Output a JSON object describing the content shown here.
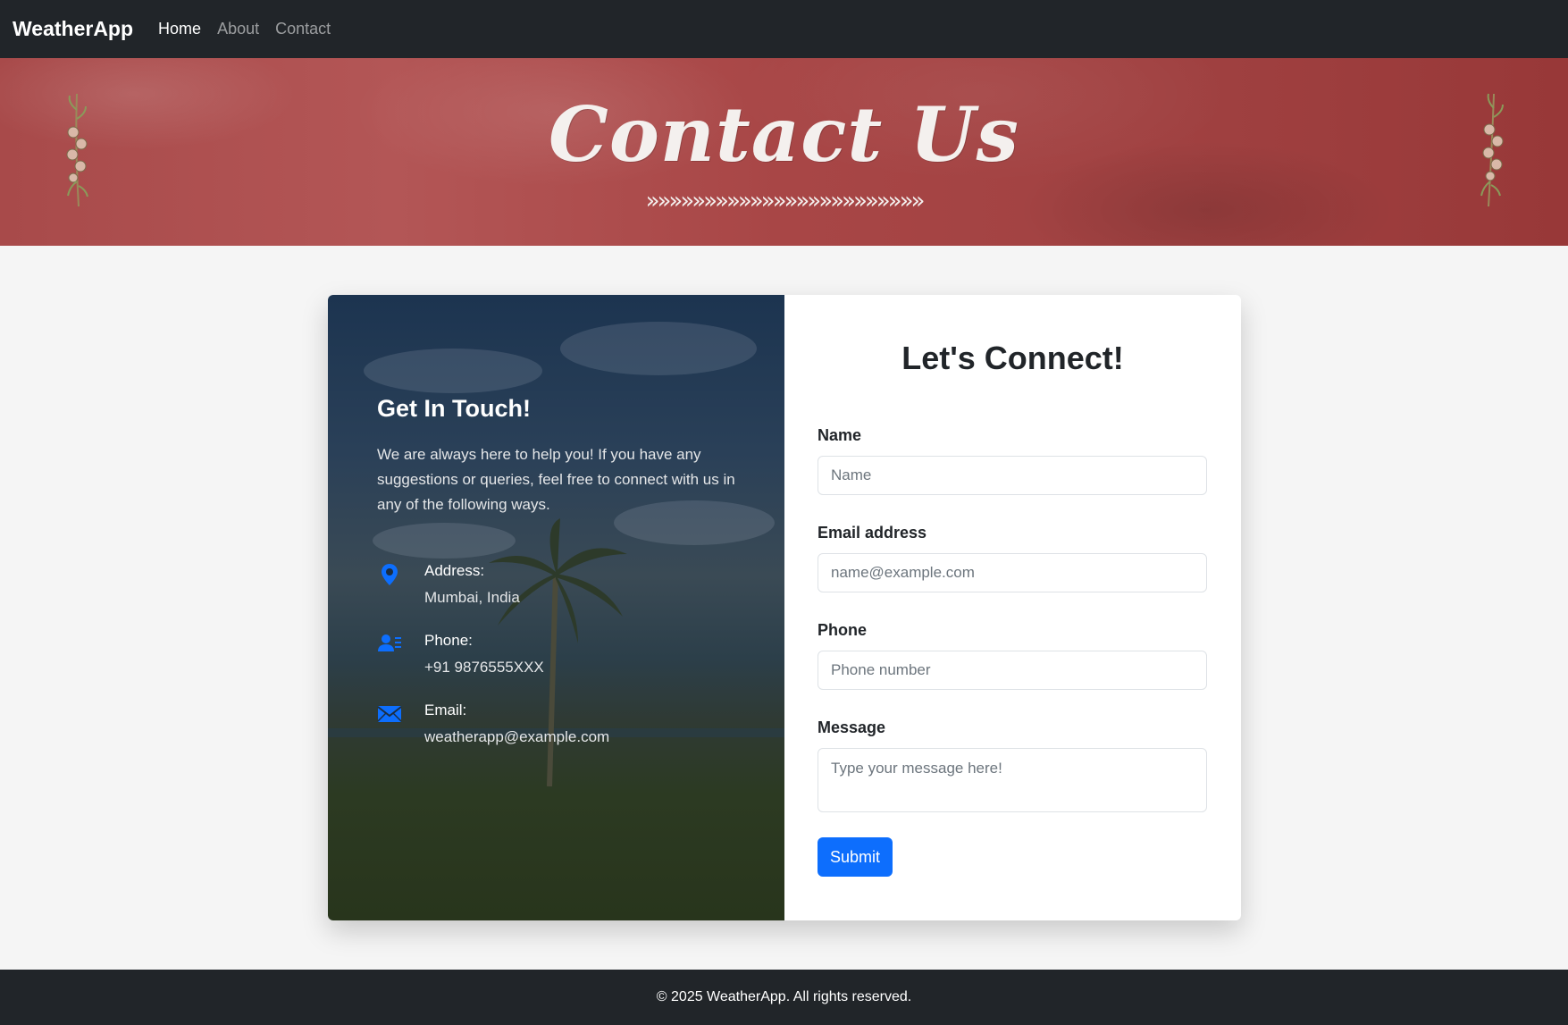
{
  "navbar": {
    "brand": "WeatherApp",
    "links": [
      {
        "label": "Home",
        "active": true
      },
      {
        "label": "About",
        "active": false
      },
      {
        "label": "Contact",
        "active": false
      }
    ]
  },
  "hero": {
    "title": "Contact Us",
    "chevrons": "»»»»»»»»»»»»»»»»»»»»»»»»"
  },
  "info": {
    "title": "Get In Touch!",
    "description": "We are always here to help you! If you have any suggestions or queries, feel free to connect with us in any of the following ways.",
    "items": [
      {
        "icon": "map-pin-icon",
        "label": "Address:",
        "value": "Mumbai, India"
      },
      {
        "icon": "contact-card-icon",
        "label": "Phone:",
        "value": "+91 9876555XXX"
      },
      {
        "icon": "envelope-icon",
        "label": "Email:",
        "value": "weatherapp@example.com"
      }
    ]
  },
  "form": {
    "title": "Let's Connect!",
    "name": {
      "label": "Name",
      "placeholder": "Name",
      "value": ""
    },
    "email": {
      "label": "Email address",
      "placeholder": "name@example.com",
      "value": ""
    },
    "phone": {
      "label": "Phone",
      "placeholder": "Phone number",
      "value": ""
    },
    "message": {
      "label": "Message",
      "placeholder": "Type your message here!",
      "value": ""
    },
    "submit_label": "Submit"
  },
  "footer": {
    "text": "© 2025 WeatherApp. All rights reserved."
  },
  "colors": {
    "navbar_bg": "#212529",
    "hero_bg": "#a84848",
    "primary": "#0d6efd",
    "page_bg": "#f5f5f5"
  }
}
